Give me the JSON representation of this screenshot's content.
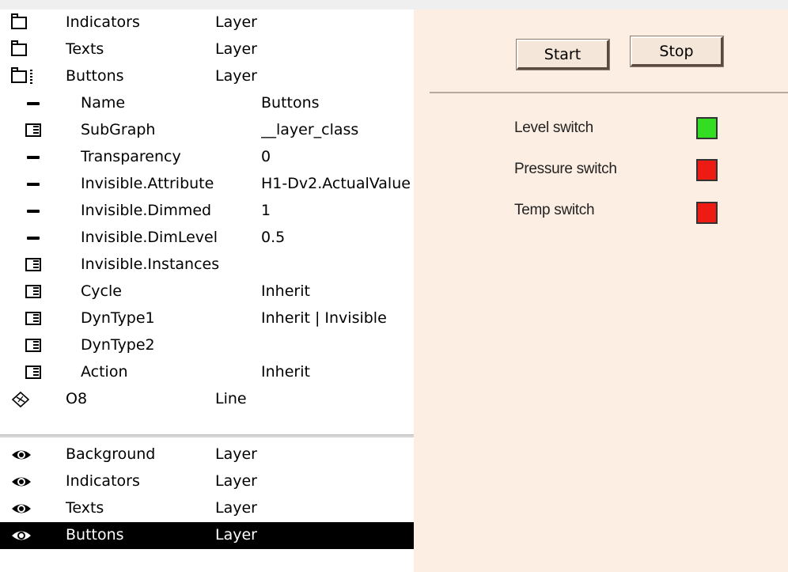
{
  "tree_top": [
    {
      "name": "Indicators",
      "type": "Layer",
      "icon": "folder-icon"
    },
    {
      "name": "Texts",
      "type": "Layer",
      "icon": "folder-icon"
    },
    {
      "name": "Buttons",
      "type": "Layer",
      "icon": "folder-open-icon"
    }
  ],
  "attributes": [
    {
      "name": "Name",
      "value": "Buttons",
      "icon": "dash-icon"
    },
    {
      "name": "SubGraph",
      "value": "__layer_class",
      "icon": "attribute-group-icon"
    },
    {
      "name": "Transparency",
      "value": "0",
      "icon": "dash-icon"
    },
    {
      "name": "Invisible.Attribute",
      "value": "H1-Dv2.ActualValue",
      "icon": "dash-icon"
    },
    {
      "name": "Invisible.Dimmed",
      "value": "1",
      "icon": "dash-icon"
    },
    {
      "name": "Invisible.DimLevel",
      "value": "0.5",
      "icon": "dash-icon"
    },
    {
      "name": "Invisible.Instances",
      "value": "",
      "icon": "attribute-group-icon"
    },
    {
      "name": "Cycle",
      "value": "Inherit",
      "icon": "attribute-group-icon"
    },
    {
      "name": "DynType1",
      "value": "Inherit | Invisible",
      "icon": "attribute-group-icon"
    },
    {
      "name": "DynType2",
      "value": "",
      "icon": "attribute-group-icon"
    },
    {
      "name": "Action",
      "value": "Inherit",
      "icon": "attribute-group-icon"
    }
  ],
  "tree_o8": {
    "name": "O8",
    "type": "Line",
    "icon": "line-object-icon"
  },
  "tree_bottom": [
    {
      "name": "Background",
      "type": "Layer",
      "icon": "eye-icon",
      "selected": false
    },
    {
      "name": "Indicators",
      "type": "Layer",
      "icon": "eye-icon",
      "selected": false
    },
    {
      "name": "Texts",
      "type": "Layer",
      "icon": "eye-icon",
      "selected": false
    },
    {
      "name": "Buttons",
      "type": "Layer",
      "icon": "eye-icon",
      "selected": true
    }
  ],
  "preview": {
    "start_label": "Start",
    "stop_label": "Stop",
    "indicators": [
      {
        "label": "Level switch",
        "color": "#33dd22"
      },
      {
        "label": "Pressure switch",
        "color": "#ee1a14"
      },
      {
        "label": "Temp switch",
        "color": "#ee1a14"
      }
    ]
  },
  "colors": {
    "preview_background": "#fdeee4",
    "selection": "#000000"
  }
}
